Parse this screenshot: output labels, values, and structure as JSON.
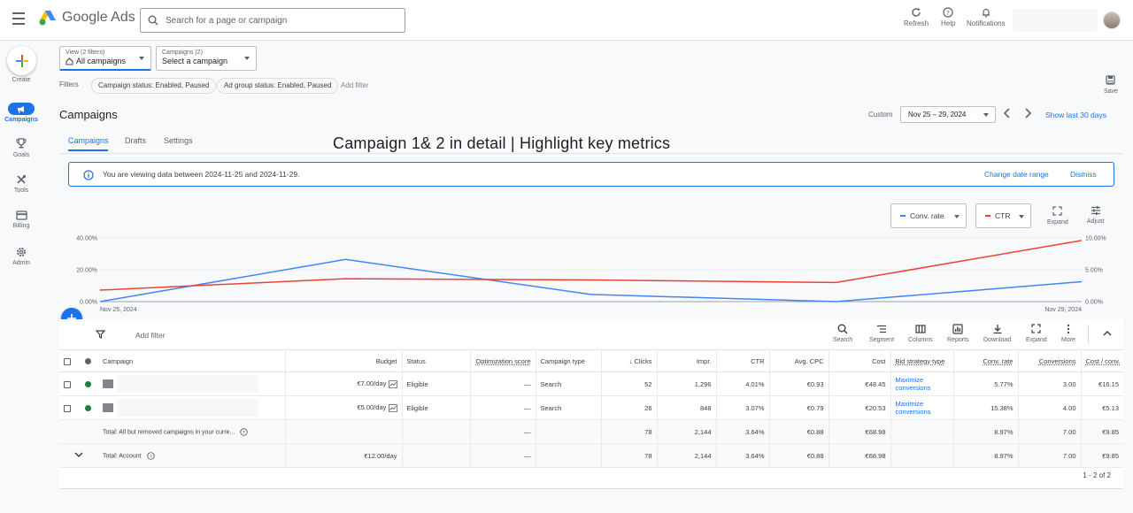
{
  "app": {
    "name": "Google Ads"
  },
  "search": {
    "placeholder": "Search for a page or campaign"
  },
  "top_actions": {
    "refresh": "Refresh",
    "help": "Help",
    "notifications": "Notifications"
  },
  "nav": {
    "create": "Create",
    "items": [
      {
        "label": "Campaigns",
        "icon": "megaphone-icon",
        "active": true
      },
      {
        "label": "Goals",
        "icon": "trophy-icon"
      },
      {
        "label": "Tools",
        "icon": "tools-icon"
      },
      {
        "label": "Billing",
        "icon": "card-icon"
      },
      {
        "label": "Admin",
        "icon": "gear-icon"
      }
    ]
  },
  "view_filter": {
    "label": "View (2 filters)",
    "value": "All campaigns"
  },
  "campaign_filter": {
    "label": "Campaigns (2)",
    "value": "Select a campaign"
  },
  "filters": {
    "label": "Filters",
    "chips": [
      "Campaign status: Enabled, Paused",
      "Ad group status: Enabled, Paused"
    ],
    "add": "Add filter"
  },
  "save_label": "Save",
  "page_title": "Campaigns",
  "tabs": [
    "Campaigns",
    "Drafts",
    "Settings"
  ],
  "overlay_title": "Campaign 1& 2 in detail | Highlight key metrics",
  "date": {
    "mode": "Custom",
    "range": "Nov 25 – 29, 2024",
    "shortcut": "Show last 30 days"
  },
  "banner": {
    "text": "You are viewing data between 2024-11-25 and 2024-11-29.",
    "change": "Change date range",
    "dismiss": "Dismiss"
  },
  "metrics": {
    "metric1": "Conv. rate",
    "metric2": "CTR",
    "expand": "Expand",
    "adjust": "Adjust"
  },
  "colors": {
    "blue": "#4285f4",
    "red": "#ea4335",
    "accent": "#1a73e8",
    "green": "#188038"
  },
  "chart_data": {
    "type": "line",
    "x": [
      "Nov 25, 2024",
      "Nov 26, 2024",
      "Nov 27, 2024",
      "Nov 28, 2024",
      "Nov 29, 2024"
    ],
    "x_tick_labels": [
      "Nov 25, 2024",
      "Nov 29, 2024"
    ],
    "y_left": {
      "ticks": [
        "40.00%",
        "20.00%",
        "0.00%"
      ],
      "range": [
        0,
        40
      ]
    },
    "y_right": {
      "ticks": [
        "10.00%",
        "5.00%",
        "0.00%"
      ],
      "range": [
        0,
        10
      ]
    },
    "series": [
      {
        "name": "Conv. rate",
        "axis": "left",
        "color": "#4285f4",
        "values": [
          0.0,
          26.5,
          4.5,
          0.0,
          12.5
        ]
      },
      {
        "name": "CTR",
        "axis": "right",
        "color": "#ea4335",
        "values": [
          1.8,
          3.6,
          3.4,
          3.0,
          9.6
        ]
      }
    ]
  },
  "table_toolbar": {
    "add_filter": "Add filter",
    "items": [
      "Search",
      "Segment",
      "Columns",
      "Reports",
      "Download",
      "Expand",
      "More"
    ]
  },
  "table": {
    "headers": [
      "Campaign",
      "Budget",
      "Status",
      "Optimization score",
      "Campaign type",
      "Clicks",
      "Impr.",
      "CTR",
      "Avg. CPC",
      "Cost",
      "Bid strategy type",
      "Conv. rate",
      "Conversions",
      "Cost / conv."
    ],
    "rows": [
      {
        "budget": "€7.00/day",
        "status": "Eligible",
        "opt": "—",
        "type": "Search",
        "clicks": "52",
        "impr": "1,296",
        "ctr": "4.01%",
        "cpc": "€0.93",
        "cost": "€48.45",
        "bid": "Maximize conversions",
        "conv_rate": "5.77%",
        "conversions": "3.00",
        "cost_conv": "€16.15"
      },
      {
        "budget": "€5.00/day",
        "status": "Eligible",
        "opt": "—",
        "type": "Search",
        "clicks": "26",
        "impr": "848",
        "ctr": "3.07%",
        "cpc": "€0.79",
        "cost": "€20.53",
        "bid": "Maximize conversions",
        "conv_rate": "15.38%",
        "conversions": "4.00",
        "cost_conv": "€5.13"
      }
    ],
    "total_removed": {
      "label": "Total: All but removed campaigns in your curre...",
      "opt": "—",
      "clicks": "78",
      "impr": "2,144",
      "ctr": "3.64%",
      "cpc": "€0.88",
      "cost": "€68.98",
      "conv_rate": "8.97%",
      "conversions": "7.00",
      "cost_conv": "€9.85"
    },
    "total_account": {
      "label": "Total: Account",
      "budget": "€12.00/day",
      "opt": "—",
      "clicks": "78",
      "impr": "2,144",
      "ctr": "3.64%",
      "cpc": "€0.88",
      "cost": "€68.98",
      "conv_rate": "8.97%",
      "conversions": "7.00",
      "cost_conv": "€9.85"
    }
  },
  "pagination": "1 - 2 of 2"
}
